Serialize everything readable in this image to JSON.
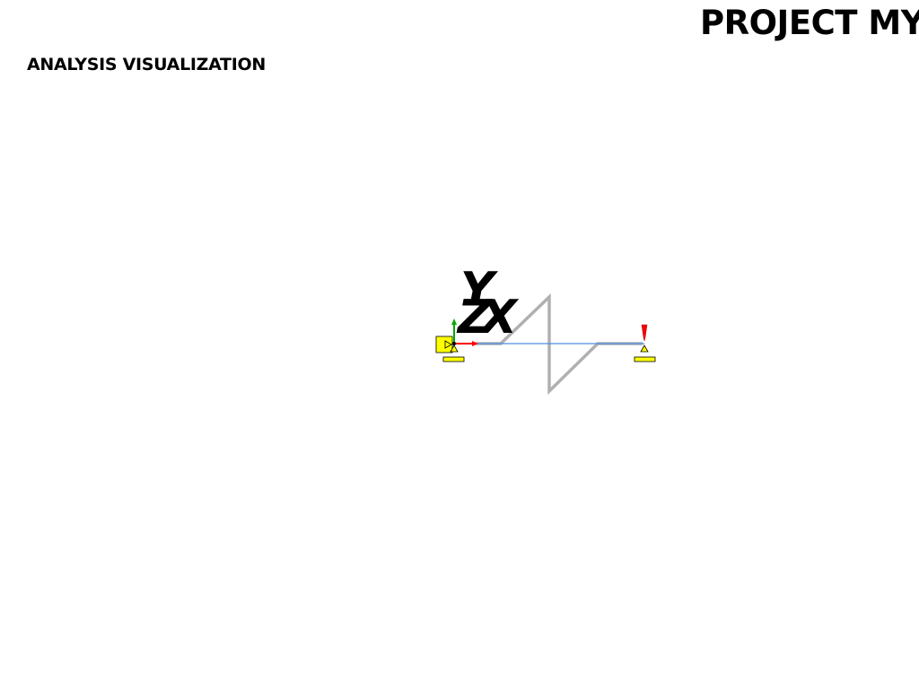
{
  "header": {
    "project_title": "PROJECT MYP",
    "subtitle": "ANALYSIS VISUALIZATION"
  },
  "axes": {
    "y_label": "Y",
    "z_label": "Z",
    "x_label": "X"
  },
  "colors": {
    "background": "#ffffff",
    "member_line": "#4a90e2",
    "deflected_shape": "#b0b0b0",
    "support": "#ffff00",
    "x_axis": "#ff0000",
    "y_axis": "#00aa00",
    "load_arrow": "#ff0000"
  },
  "icons": {
    "left_support": "fixed-support-icon",
    "right_support": "roller-support-icon",
    "load": "point-load-arrow-icon"
  }
}
